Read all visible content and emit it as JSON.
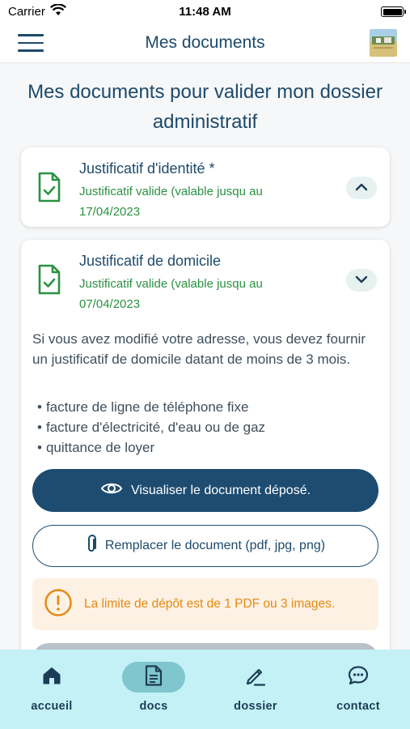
{
  "status_bar": {
    "carrier": "Carrier",
    "time": "11:48 AM"
  },
  "header": {
    "title": "Mes documents"
  },
  "page_title": "Mes documents pour valider mon dossier administratif",
  "documents": [
    {
      "title": "Justificatif d'identité *",
      "status": "Justificatif  valide (valable jusqu au 17/04/2023",
      "expanded": true
    },
    {
      "title": "Justificatif de domicile",
      "status": "Justificatif  valide (valable jusqu au 07/04/2023",
      "expanded": false
    }
  ],
  "domicile_details": {
    "description": "Si vous avez modifié votre adresse, vous devez fournir un justificatif de domicile datant de moins de 3 mois.",
    "bullets": [
      "facture de ligne de téléphone fixe",
      "facture d'électricité, d'eau ou de gaz",
      "quittance de loyer"
    ],
    "view_button": "Visualiser le document déposé.",
    "replace_button": "Remplacer le document (pdf, jpg, png)",
    "warning": "La limite de dépôt est de 1 PDF ou 3 images."
  },
  "tabs": [
    {
      "label": "accueil",
      "icon": "home-icon",
      "active": false
    },
    {
      "label": "docs",
      "icon": "document-icon",
      "active": true
    },
    {
      "label": "dossier",
      "icon": "pencil-icon",
      "active": false
    },
    {
      "label": "contact",
      "icon": "chat-icon",
      "active": false
    }
  ],
  "colors": {
    "primary": "#1e4c70",
    "success": "#2a9141",
    "warning": "#e58a15",
    "tabbar": "#c3f1f6",
    "active_tab": "#7fc6cf"
  }
}
